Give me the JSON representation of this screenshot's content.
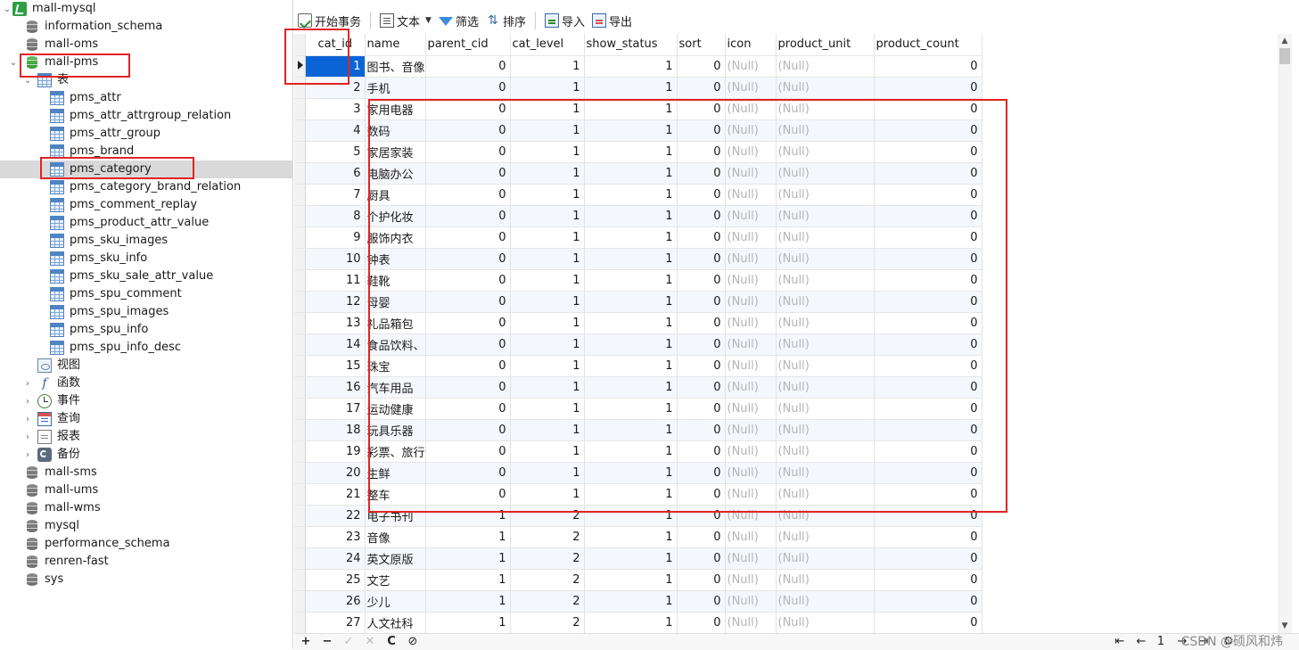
{
  "tree": {
    "connection": "mall-mysql",
    "databases_before": [
      "information_schema",
      "mall-oms"
    ],
    "open_db": "mall-pms",
    "tables_folder": "表",
    "tables": [
      "pms_attr",
      "pms_attr_attrgroup_relation",
      "pms_attr_group",
      "pms_brand",
      "pms_category",
      "pms_category_brand_relation",
      "pms_comment_replay",
      "pms_product_attr_value",
      "pms_sku_images",
      "pms_sku_info",
      "pms_sku_sale_attr_value",
      "pms_spu_comment",
      "pms_spu_images",
      "pms_spu_info",
      "pms_spu_info_desc"
    ],
    "selected_table": "pms_category",
    "folders": {
      "views": "视图",
      "functions": "函数",
      "events": "事件",
      "queries": "查询",
      "reports": "报表",
      "backups": "备份"
    },
    "databases_after": [
      "mall-sms",
      "mall-ums",
      "mall-wms",
      "mysql",
      "performance_schema",
      "renren-fast",
      "sys"
    ]
  },
  "toolbar": {
    "begin_transaction": "开始事务",
    "text": "文本",
    "filter": "筛选",
    "sort": "排序",
    "import": "导入",
    "export": "导出"
  },
  "grid": {
    "columns": [
      "cat_id",
      "name",
      "parent_cid",
      "cat_level",
      "show_status",
      "sort",
      "icon",
      "product_unit",
      "product_count"
    ],
    "null_text": "(Null)",
    "rows": [
      [
        1,
        "图书、音像",
        0,
        1,
        1,
        0,
        0
      ],
      [
        2,
        "手机",
        0,
        1,
        1,
        0,
        0
      ],
      [
        3,
        "家用电器",
        0,
        1,
        1,
        0,
        0
      ],
      [
        4,
        "数码",
        0,
        1,
        1,
        0,
        0
      ],
      [
        5,
        "家居家装",
        0,
        1,
        1,
        0,
        0
      ],
      [
        6,
        "电脑办公",
        0,
        1,
        1,
        0,
        0
      ],
      [
        7,
        "厨具",
        0,
        1,
        1,
        0,
        0
      ],
      [
        8,
        "个护化妆",
        0,
        1,
        1,
        0,
        0
      ],
      [
        9,
        "服饰内衣",
        0,
        1,
        1,
        0,
        0
      ],
      [
        10,
        "钟表",
        0,
        1,
        1,
        0,
        0
      ],
      [
        11,
        "鞋靴",
        0,
        1,
        1,
        0,
        0
      ],
      [
        12,
        "母婴",
        0,
        1,
        1,
        0,
        0
      ],
      [
        13,
        "礼品箱包",
        0,
        1,
        1,
        0,
        0
      ],
      [
        14,
        "食品饮料、",
        0,
        1,
        1,
        0,
        0
      ],
      [
        15,
        "珠宝",
        0,
        1,
        1,
        0,
        0
      ],
      [
        16,
        "汽车用品",
        0,
        1,
        1,
        0,
        0
      ],
      [
        17,
        "运动健康",
        0,
        1,
        1,
        0,
        0
      ],
      [
        18,
        "玩具乐器",
        0,
        1,
        1,
        0,
        0
      ],
      [
        19,
        "彩票、旅行",
        0,
        1,
        1,
        0,
        0
      ],
      [
        20,
        "生鲜",
        0,
        1,
        1,
        0,
        0
      ],
      [
        21,
        "整车",
        0,
        1,
        1,
        0,
        0
      ],
      [
        22,
        "电子书刊",
        1,
        2,
        1,
        0,
        0
      ],
      [
        23,
        "音像",
        1,
        2,
        1,
        0,
        0
      ],
      [
        24,
        "英文原版",
        1,
        2,
        1,
        0,
        0
      ],
      [
        25,
        "文艺",
        1,
        2,
        1,
        0,
        0
      ],
      [
        26,
        "少儿",
        1,
        2,
        1,
        0,
        0
      ],
      [
        27,
        "人文社科",
        1,
        2,
        1,
        0,
        0
      ]
    ]
  },
  "statusbar": {
    "add": "+",
    "delete": "−",
    "apply": "✓",
    "cancel": "✕",
    "refresh": "C",
    "stop": "⊘",
    "first": "⇤",
    "prev": "←",
    "page": "1",
    "next": "→",
    "last": "⇥",
    "settings": "⚙"
  },
  "watermark": "CSDN @硕风和炜"
}
